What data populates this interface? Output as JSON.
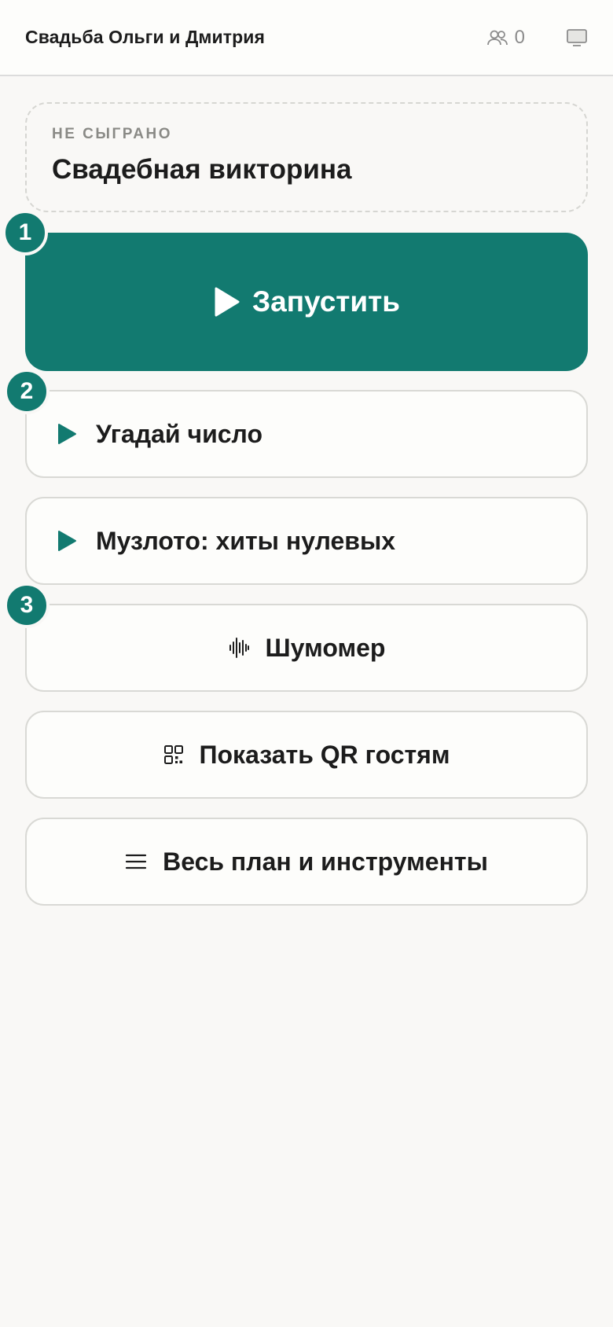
{
  "header": {
    "title": "Свадьба Ольги и Дмитрия",
    "guest_count": "0",
    "guests_icon": "users-icon",
    "screen_icon": "monitor-icon"
  },
  "status_card": {
    "label": "НЕ СЫГРАНО",
    "title": "Свадебная викторина"
  },
  "launch": {
    "label": "Запустить",
    "icon": "play-icon",
    "step": "1"
  },
  "actions": [
    {
      "label": "Угадай число",
      "icon": "play-icon",
      "step": "2"
    },
    {
      "label": "Музлото: хиты нулевых",
      "icon": "play-icon"
    },
    {
      "label": "Шумомер",
      "icon": "sound-wave-icon",
      "step": "3"
    },
    {
      "label": "Показать QR гостям",
      "icon": "qr-code-icon"
    },
    {
      "label": "Весь план и инструменты",
      "icon": "menu-icon"
    }
  ],
  "colors": {
    "accent": "#127a70",
    "background": "#f9f8f6",
    "text": "#1c1c1c",
    "muted": "#8a8a86"
  }
}
